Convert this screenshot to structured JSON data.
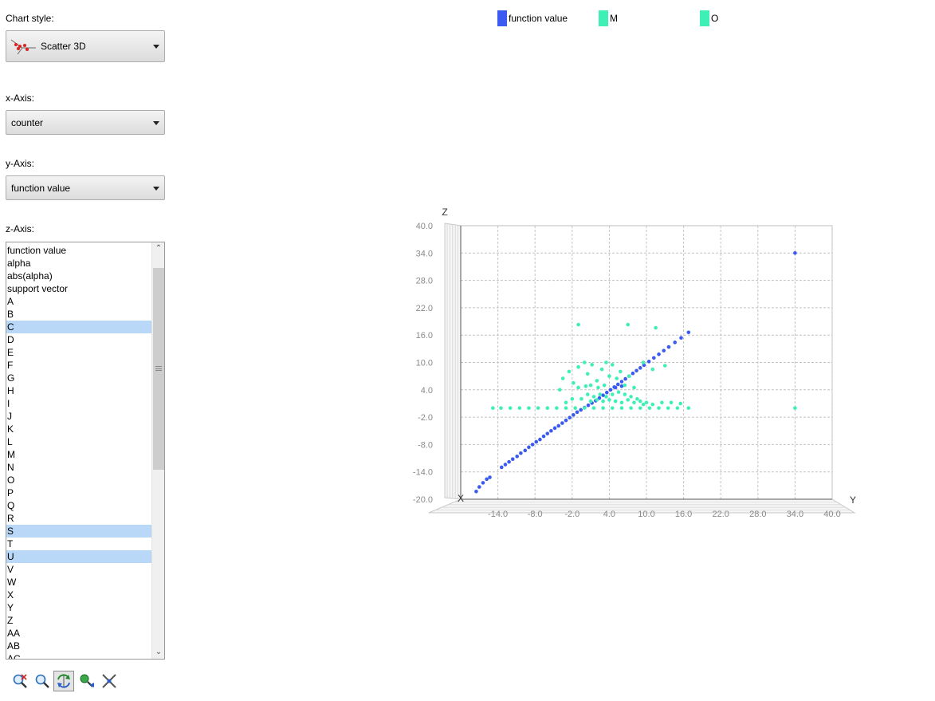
{
  "sidebar": {
    "chart_style_label": "Chart style:",
    "chart_style_value": "Scatter 3D",
    "x_axis_label": "x-Axis:",
    "x_axis_value": "counter",
    "y_axis_label": "y-Axis:",
    "y_axis_value": "function value",
    "z_axis_label": "z-Axis:",
    "z_axis_items": [
      "function value",
      "alpha",
      "abs(alpha)",
      "support vector",
      "A",
      "B",
      "C",
      "D",
      "E",
      "F",
      "G",
      "H",
      "I",
      "J",
      "K",
      "L",
      "M",
      "N",
      "O",
      "P",
      "Q",
      "R",
      "S",
      "T",
      "U",
      "V",
      "W",
      "X",
      "Y",
      "Z",
      "AA",
      "AB",
      "AC"
    ],
    "z_axis_selected": [
      "C",
      "S",
      "U"
    ]
  },
  "toolbar": {
    "icons": [
      "zoom-reset-icon",
      "zoom-icon",
      "rotate-icon",
      "color-icon",
      "settings-icon"
    ],
    "active": "rotate-icon"
  },
  "legend": [
    {
      "name": "function value",
      "color": "#3b5bf0"
    },
    {
      "name": "M",
      "color": "#3ff0b6"
    },
    {
      "name": "O",
      "color": "#3ff0b6"
    }
  ],
  "chart_data": {
    "type": "scatter",
    "xlabel": "X",
    "ylabel": "Y",
    "zlabel": "Z",
    "y_ticks": [
      "-14.0",
      "-8.0",
      "-2.0",
      "4.0",
      "10.0",
      "16.0",
      "22.0",
      "28.0",
      "34.0",
      "40.0"
    ],
    "z_ticks": [
      "-20.0",
      "-14.0",
      "-8.0",
      "-2.0",
      "4.0",
      "10.0",
      "16.0",
      "22.0",
      "28.0",
      "34.0",
      "40.0"
    ],
    "ylim": [
      -20,
      40
    ],
    "zlim": [
      -20,
      40
    ],
    "grid": true,
    "series": [
      {
        "name": "function value",
        "color": "#3b5bf0",
        "points": [
          [
            -17.5,
            -18.3
          ],
          [
            -17,
            -17.3
          ],
          [
            -16.4,
            -16.4
          ],
          [
            -15.8,
            -15.6
          ],
          [
            -15.3,
            -15.2
          ],
          [
            -13.4,
            -13
          ],
          [
            -12.8,
            -12.4
          ],
          [
            -12.2,
            -11.8
          ],
          [
            -11.6,
            -11.2
          ],
          [
            -10.9,
            -10.6
          ],
          [
            -10.3,
            -9.9
          ],
          [
            -9.6,
            -9.3
          ],
          [
            -9,
            -8.6
          ],
          [
            -8.4,
            -8
          ],
          [
            -7.8,
            -7.4
          ],
          [
            -7.2,
            -6.9
          ],
          [
            -6.6,
            -6.2
          ],
          [
            -6,
            -5.6
          ],
          [
            -5.4,
            -5
          ],
          [
            -4.8,
            -4.4
          ],
          [
            -4.2,
            -3.9
          ],
          [
            -3.6,
            -3.3
          ],
          [
            -3,
            -2.7
          ],
          [
            -2.4,
            -2.1
          ],
          [
            -1.8,
            -1.5
          ],
          [
            -1.2,
            -0.9
          ],
          [
            -0.6,
            -0.4
          ],
          [
            0,
            0.1
          ],
          [
            0.6,
            0.6
          ],
          [
            1.2,
            1.1
          ],
          [
            1.8,
            1.6
          ],
          [
            2.4,
            2.2
          ],
          [
            3,
            2.8
          ],
          [
            3.6,
            3.4
          ],
          [
            4.2,
            4
          ],
          [
            4.8,
            4.6
          ],
          [
            5.4,
            5.2
          ],
          [
            6,
            5.8
          ],
          [
            6.6,
            6.4
          ],
          [
            7.2,
            7
          ],
          [
            7.8,
            7.6
          ],
          [
            8.4,
            8.2
          ],
          [
            9,
            8.8
          ],
          [
            9.6,
            9.4
          ],
          [
            10.4,
            10.2
          ],
          [
            11.2,
            11
          ],
          [
            12,
            11.8
          ],
          [
            12.8,
            12.6
          ],
          [
            13.6,
            13.4
          ],
          [
            14.6,
            14.4
          ],
          [
            15.6,
            15.4
          ],
          [
            16.8,
            16.6
          ],
          [
            34,
            34
          ],
          [
            5,
            4.5
          ],
          [
            6,
            4.8
          ]
        ]
      },
      {
        "name": "M",
        "color": "#3ff0b6",
        "points": [
          [
            -14.8,
            0
          ],
          [
            -13.5,
            0
          ],
          [
            -12,
            0
          ],
          [
            -10.5,
            0
          ],
          [
            -9,
            0
          ],
          [
            -7.5,
            0
          ],
          [
            -6,
            0
          ],
          [
            -4.5,
            0
          ],
          [
            -3,
            0
          ],
          [
            -1.5,
            0
          ],
          [
            0,
            0
          ],
          [
            1.5,
            0
          ],
          [
            3,
            0
          ],
          [
            4.5,
            0
          ],
          [
            6,
            0
          ],
          [
            7.5,
            0
          ],
          [
            9,
            0
          ],
          [
            10.5,
            0
          ],
          [
            12,
            0
          ],
          [
            13.5,
            0
          ],
          [
            15,
            0
          ],
          [
            16.8,
            0
          ],
          [
            34,
            0
          ],
          [
            -1,
            18.3
          ],
          [
            7,
            18.3
          ],
          [
            11.5,
            17.6
          ],
          [
            13,
            9.3
          ],
          [
            9.5,
            10
          ],
          [
            11,
            8.5
          ],
          [
            -4,
            4
          ],
          [
            -3.5,
            6.5
          ],
          [
            -2.5,
            8
          ],
          [
            -1.8,
            5.5
          ],
          [
            -1,
            9
          ],
          [
            0,
            10
          ],
          [
            0.5,
            7.5
          ],
          [
            1.2,
            9.5
          ],
          [
            2,
            6
          ],
          [
            2.8,
            8.5
          ],
          [
            3.5,
            10
          ],
          [
            4,
            7
          ],
          [
            4.5,
            9.5
          ],
          [
            5.2,
            6.5
          ],
          [
            5.8,
            8
          ],
          [
            6.5,
            5
          ],
          [
            7.2,
            7
          ],
          [
            8,
            4.5
          ],
          [
            0.5,
            3
          ],
          [
            1.5,
            2.5
          ],
          [
            2.5,
            3
          ],
          [
            3.5,
            2.5
          ],
          [
            4.5,
            3
          ],
          [
            -0.5,
            2
          ],
          [
            1,
            1.5
          ],
          [
            2,
            1.8
          ],
          [
            3,
            1.5
          ],
          [
            4,
            1.8
          ],
          [
            5,
            1.5
          ],
          [
            6,
            1.2
          ],
          [
            7,
            1.8
          ],
          [
            8,
            1.2
          ],
          [
            9,
            1.5
          ],
          [
            10,
            1.2
          ],
          [
            11,
            0.8
          ],
          [
            -2,
            2
          ],
          [
            -3,
            1.2
          ],
          [
            -1,
            4.5
          ],
          [
            0.2,
            4.8
          ],
          [
            1,
            5
          ],
          [
            2.2,
            4.5
          ],
          [
            3.2,
            5
          ],
          [
            5.5,
            3.5
          ],
          [
            6.5,
            3
          ],
          [
            7.5,
            2.5
          ],
          [
            8.5,
            2
          ],
          [
            9.5,
            0.8
          ],
          [
            12.5,
            1.2
          ],
          [
            14,
            1.2
          ],
          [
            15.5,
            1
          ]
        ]
      }
    ]
  }
}
